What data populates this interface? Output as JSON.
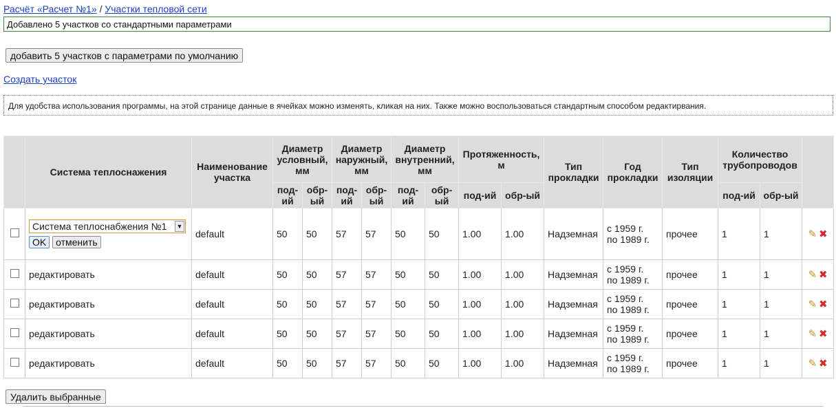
{
  "breadcrumb": {
    "calc_link": "Расчёт «Расчет №1»",
    "separator": "/",
    "sections_link": "Участки тепловой сети"
  },
  "flash_message": "Добавлено 5 участков со стандартными параметрами",
  "add_default_button": "добавить 5 участков с параметрами по умолчанию",
  "create_link": "Создать участок",
  "hint": "Для удобства использования программы, на этой странице данные в ячейках можно изменять, кликая на них. Также можно воспользоваться стандартным способом редактирвания.",
  "table": {
    "headers": {
      "system": "Система теплоснажения",
      "name": "Наименование участка",
      "diam_cond": "Диаметр условный, мм",
      "diam_outer": "Диаметр наружный, мм",
      "diam_inner": "Диаметр внутренний, мм",
      "length": "Протяженность, м",
      "lay_type": "Тип прокладки",
      "lay_year": "Год прокладки",
      "insul_type": "Тип изоляции",
      "pipe_count": "Количество трубопроводов",
      "sub_supply": "под-ий",
      "sub_return": "обр-ый"
    },
    "editor": {
      "selected_system": "Система теплоснабжения №1",
      "ok_label": "OK",
      "cancel_label": "отменить"
    },
    "edit_label": "редактировать",
    "rows": [
      {
        "name": "default",
        "dc_s": "50",
        "dc_r": "50",
        "do_s": "57",
        "do_r": "57",
        "di_s": "50",
        "di_r": "50",
        "len_s": "1.00",
        "len_r": "1.00",
        "lay": "Надземная",
        "year_1": "с 1959 г.",
        "year_2": "по 1989 г.",
        "insul": "прочее",
        "pc_s": "1",
        "pc_r": "1"
      },
      {
        "name": "default",
        "dc_s": "50",
        "dc_r": "50",
        "do_s": "57",
        "do_r": "57",
        "di_s": "50",
        "di_r": "50",
        "len_s": "1.00",
        "len_r": "1.00",
        "lay": "Надземная",
        "year_1": "с 1959 г.",
        "year_2": "по 1989 г.",
        "insul": "прочее",
        "pc_s": "1",
        "pc_r": "1"
      },
      {
        "name": "default",
        "dc_s": "50",
        "dc_r": "50",
        "do_s": "57",
        "do_r": "57",
        "di_s": "50",
        "di_r": "50",
        "len_s": "1.00",
        "len_r": "1.00",
        "lay": "Надземная",
        "year_1": "с 1959 г.",
        "year_2": "по 1989 г.",
        "insul": "прочее",
        "pc_s": "1",
        "pc_r": "1"
      },
      {
        "name": "default",
        "dc_s": "50",
        "dc_r": "50",
        "do_s": "57",
        "do_r": "57",
        "di_s": "50",
        "di_r": "50",
        "len_s": "1.00",
        "len_r": "1.00",
        "lay": "Надземная",
        "year_1": "с 1959 г.",
        "year_2": "по 1989 г.",
        "insul": "прочее",
        "pc_s": "1",
        "pc_r": "1"
      },
      {
        "name": "default",
        "dc_s": "50",
        "dc_r": "50",
        "do_s": "57",
        "do_r": "57",
        "di_s": "50",
        "di_r": "50",
        "len_s": "1.00",
        "len_r": "1.00",
        "lay": "Надземная",
        "year_1": "с 1959 г.",
        "year_2": "по 1989 г.",
        "insul": "прочее",
        "pc_s": "1",
        "pc_r": "1"
      }
    ]
  },
  "delete_selected_button": "Удалить выбранные",
  "icons": {
    "edit": "pencil-icon",
    "delete": "delete-cross-icon"
  },
  "colors": {
    "header_bg": "#dcdcdc",
    "flash_border": "#3a8a3a",
    "link": "#1a3ec8",
    "delete_icon": "#d62a2a",
    "edit_icon": "#c98a1a"
  }
}
